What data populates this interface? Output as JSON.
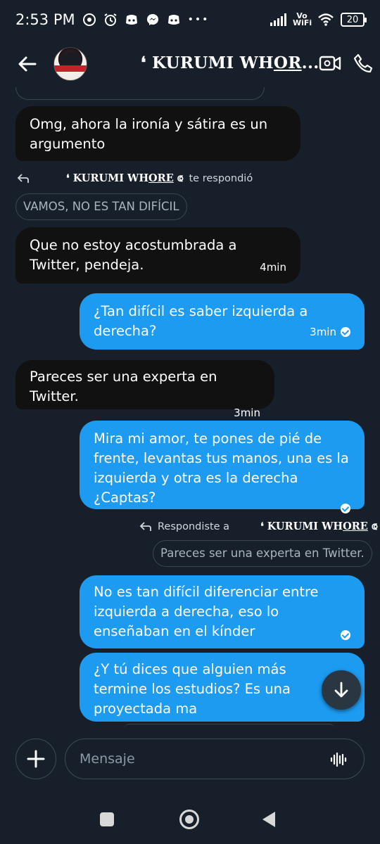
{
  "status_bar": {
    "time": "2:53 PM",
    "left_icons": [
      "whatsapp-icon",
      "alarm-icon",
      "discord-icon",
      "messenger-icon",
      "discord-icon"
    ],
    "more": "•••",
    "network": "Vo WiFi",
    "battery": "20"
  },
  "header": {
    "back_icon": "arrow-left-icon",
    "title_prefix": "❛ KURUMI WH",
    "title_underlined": "OR",
    "title_suffix": "...",
    "video_icon": "video-call-icon",
    "call_icon": "phone-icon"
  },
  "messages": [
    {
      "id": "m1",
      "direction": "in",
      "text": "Omg, ahora la ironía y sátira es un argumento",
      "time": ""
    },
    {
      "id": "m2",
      "direction": "in",
      "text": "Que no estoy acostumbrada a Twitter, pendeja.",
      "time": "4min"
    },
    {
      "id": "m3",
      "direction": "out",
      "text": "¿Tan difícil es saber izquierda a derecha?",
      "time": "3min"
    },
    {
      "id": "m4",
      "direction": "in",
      "text": "Pareces ser una experta en Twitter.",
      "time": "3min"
    },
    {
      "id": "m5",
      "direction": "out",
      "text": "Mira mi amor, te pones de pié de frente, levantas tus manos, una es la izquierda y otra es la derecha ¿Captas?",
      "time": ""
    },
    {
      "id": "m6",
      "direction": "out",
      "text": "No es tan difícil diferenciar entre izquierda a derecha, eso lo enseñaban en el kínder",
      "time": ""
    },
    {
      "id": "m7",
      "direction": "out",
      "text": "¿Y tú dices que alguien más termine los estudios? Es una proyectada ma",
      "time": ""
    }
  ],
  "reply_contexts": {
    "incoming": {
      "name_prefix": "❛ KURUMI WH",
      "name_underlined": "ORE",
      "name_suffix": " ⟃",
      "label": "te respondió",
      "quoted": "VAMOS, NO ES TAN DIFÍCIL"
    },
    "outgoing": {
      "label": "Respondiste a",
      "name_prefix": "❛ KURUMI WH",
      "name_underlined": "ORE",
      "name_suffix": " ⟃",
      "quoted": "Pareces ser una experta en Twitter."
    }
  },
  "composer": {
    "placeholder": "Mensaje",
    "add_icon": "plus-icon",
    "voice_icon": "voice-wave-icon"
  },
  "scroll_down_icon": "arrow-down-icon",
  "colors": {
    "background": "#17202a",
    "incoming_bubble": "#111111",
    "outgoing_bubble": "#1d9bf0"
  }
}
